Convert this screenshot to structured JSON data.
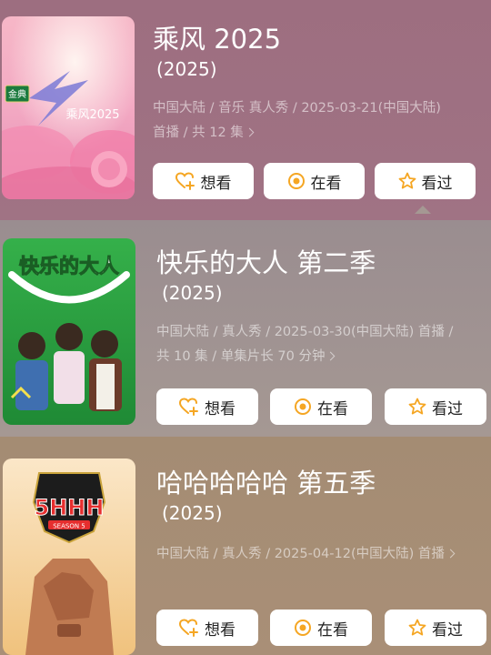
{
  "colors": {
    "accent": "#f5a623",
    "button_bg": "#ffffff"
  },
  "shows": [
    {
      "title": "乘风 2025",
      "year": "(2025)",
      "meta_line1": "中国大陆 / 音乐 真人秀 / 2025-03-21(中国大陆)",
      "meta_line2": "首播 / 共 12 集",
      "poster_badge": "金典",
      "poster_text": "乘风2025",
      "actions": {
        "want": "想看",
        "watching": "在看",
        "watched": "看过"
      }
    },
    {
      "title": "快乐的大人 第二季",
      "year": "(2025)",
      "meta_line1": "中国大陆 / 真人秀 / 2025-03-30(中国大陆) 首播 /",
      "meta_line2": "共 10 集 / 单集片长 70 分钟",
      "poster_text": "快乐的大人",
      "actions": {
        "want": "想看",
        "watching": "在看",
        "watched": "看过"
      }
    },
    {
      "title": "哈哈哈哈哈 第五季",
      "year": "(2025)",
      "meta_line1": "中国大陆 / 真人秀 / 2025-04-12(中国大陆) 首播",
      "poster_text": "5HHH",
      "poster_season": "SEASON 5",
      "actions": {
        "want": "想看",
        "watching": "在看",
        "watched": "看过"
      }
    }
  ]
}
